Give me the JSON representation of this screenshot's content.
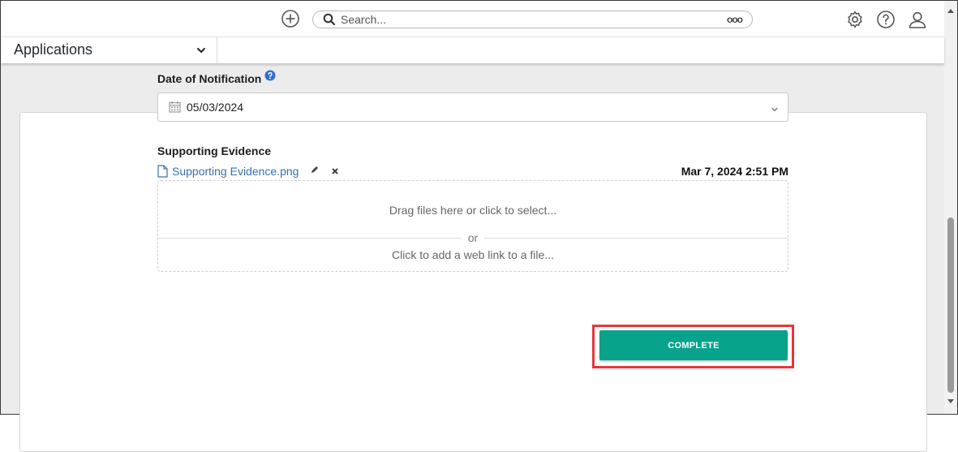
{
  "header": {
    "search": {
      "placeholder": "Search...",
      "options_glyph": "ooo"
    },
    "icons": [
      "add-icon",
      "search-icon",
      "gear-icon",
      "help-icon",
      "user-icon"
    ]
  },
  "nav": {
    "applications_label": "Applications"
  },
  "form": {
    "date_of_notification": {
      "label": "Date of Notification",
      "value": "05/03/2024"
    },
    "supporting_evidence": {
      "label": "Supporting Evidence",
      "file_name": "Supporting Evidence.png",
      "timestamp": "Mar 7, 2024 2:51 PM",
      "drop_text": "Drag files here or click to select...",
      "or_text": "or",
      "link_text": "Click to add a web link to a file..."
    },
    "complete_label": "COMPLETE"
  },
  "colors": {
    "accent": "#07a38b",
    "highlight": "#e6363b",
    "link": "#3a6fb0",
    "help": "#2f6fd0"
  }
}
